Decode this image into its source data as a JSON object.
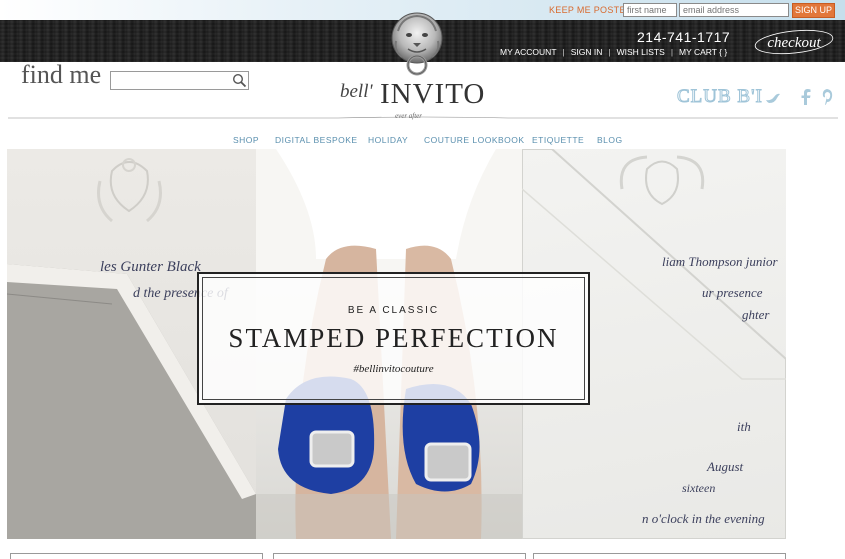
{
  "newsletter": {
    "label": "KEEP ME POSTED",
    "first_name_placeholder": "first name",
    "email_placeholder": "email address",
    "signup_label": "SIGN UP"
  },
  "header": {
    "phone": "214-741-1717",
    "account_links": [
      "MY ACCOUNT",
      "SIGN IN",
      "WISH LISTS",
      "MY CART { }"
    ],
    "checkout_label": "checkout"
  },
  "search": {
    "label": "find me",
    "placeholder": ""
  },
  "logo": {
    "prefix": "bell'",
    "name": "INVITO",
    "tagline": "ever after"
  },
  "club": {
    "label": "CLUB B'I"
  },
  "social_icons": [
    "twitter-icon",
    "facebook-icon",
    "pinterest-icon"
  ],
  "nav": {
    "items": [
      "SHOP",
      "DIGITAL BESPOKE",
      "HOLIDAY",
      "COUTURE LOOKBOOK",
      "ETIQUETTE",
      "BLOG"
    ]
  },
  "hero": {
    "kicker": "BE A CLASSIC",
    "title": "STAMPED PERFECTION",
    "hashtag": "#bellinvitocouture",
    "script_left": [
      "les Gunter Black",
      "d the presence of"
    ],
    "script_right": [
      "liam Thompson junior",
      "ur presence",
      "ghter",
      "ith",
      "August",
      "sixteen",
      "n o'clock in the evening"
    ]
  },
  "colors": {
    "accent_orange": "#e2773a",
    "nav_blue": "#5a8fae",
    "header_dark": "#222222",
    "club_blue": "#9fc4d8"
  }
}
